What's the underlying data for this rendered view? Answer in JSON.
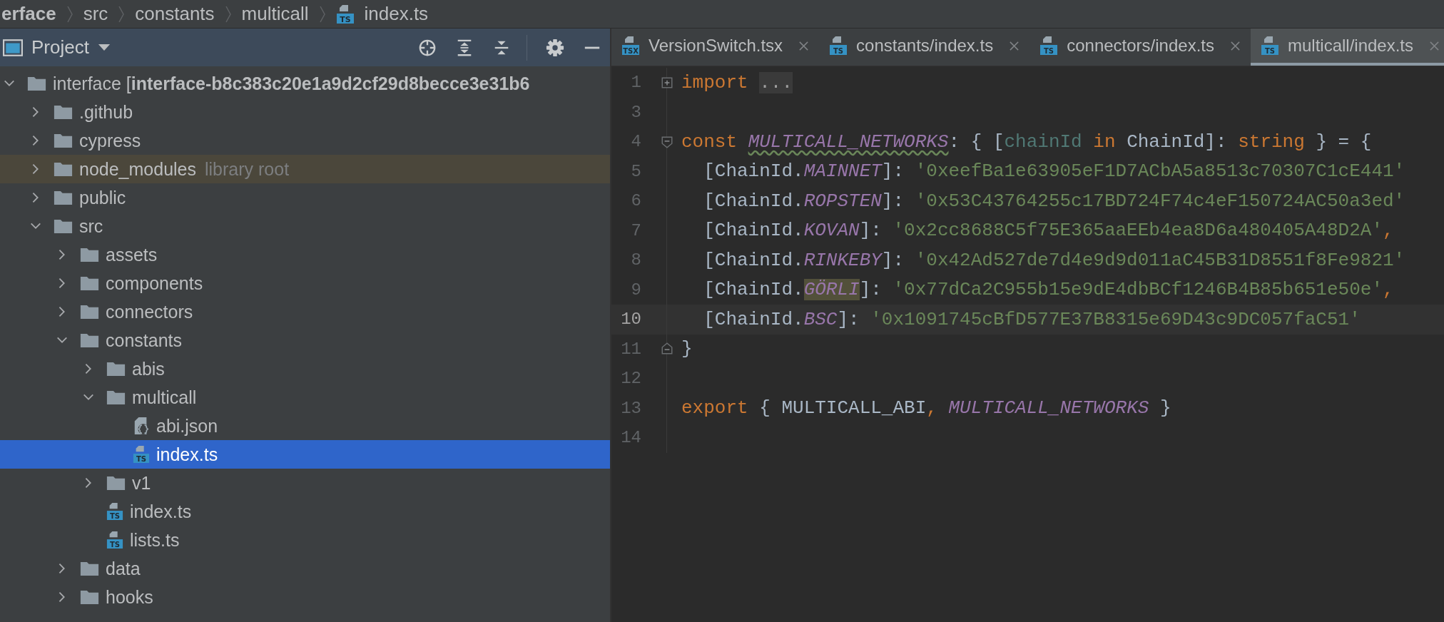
{
  "breadcrumb": [
    {
      "label": "erface",
      "kind": "root"
    },
    {
      "label": "src",
      "kind": "folder"
    },
    {
      "label": "constants",
      "kind": "folder"
    },
    {
      "label": "multicall",
      "kind": "folder"
    },
    {
      "label": "index.ts",
      "kind": "file",
      "badge": "TS"
    }
  ],
  "project_panel": {
    "title": "Project"
  },
  "tree": [
    {
      "name": "interface [**interface-b8c383c20e1a9d2cf29d8becce3e31b6**",
      "kind": "folder",
      "expanded": true,
      "selected": false,
      "children": [
        {
          "name": ".github",
          "kind": "folder",
          "expanded": false,
          "selected": false
        },
        {
          "name": "cypress",
          "kind": "folder",
          "expanded": false,
          "selected": false
        },
        {
          "name": "node_modules",
          "kind": "folder",
          "expanded": false,
          "selected": false,
          "library_root": true,
          "note": "library root"
        },
        {
          "name": "public",
          "kind": "folder",
          "expanded": false,
          "selected": false
        },
        {
          "name": "src",
          "kind": "folder",
          "expanded": true,
          "selected": false,
          "children": [
            {
              "name": "assets",
              "kind": "folder",
              "expanded": false,
              "selected": false
            },
            {
              "name": "components",
              "kind": "folder",
              "expanded": false,
              "selected": false
            },
            {
              "name": "connectors",
              "kind": "folder",
              "expanded": false,
              "selected": false
            },
            {
              "name": "constants",
              "kind": "folder",
              "expanded": true,
              "selected": false,
              "children": [
                {
                  "name": "abis",
                  "kind": "folder",
                  "expanded": false,
                  "selected": false
                },
                {
                  "name": "multicall",
                  "kind": "folder",
                  "expanded": true,
                  "selected": false,
                  "children": [
                    {
                      "name": "abi.json",
                      "kind": "json",
                      "selected": false
                    },
                    {
                      "name": "index.ts",
                      "kind": "ts",
                      "badge": "TS",
                      "selected": true
                    }
                  ]
                },
                {
                  "name": "v1",
                  "kind": "folder",
                  "expanded": false,
                  "selected": false
                },
                {
                  "name": "index.ts",
                  "kind": "ts",
                  "badge": "TS",
                  "selected": false
                },
                {
                  "name": "lists.ts",
                  "kind": "ts",
                  "badge": "TS",
                  "selected": false
                }
              ]
            },
            {
              "name": "data",
              "kind": "folder",
              "expanded": false,
              "selected": false
            },
            {
              "name": "hooks",
              "kind": "folder",
              "expanded": false,
              "selected": false
            }
          ]
        }
      ]
    }
  ],
  "tabs": [
    {
      "label": "VersionSwitch.tsx",
      "badge": "TSX",
      "selected": false
    },
    {
      "label": "constants/index.ts",
      "badge": "TS",
      "selected": false
    },
    {
      "label": "connectors/index.ts",
      "badge": "TS",
      "selected": false
    },
    {
      "label": "multicall/index.ts",
      "badge": "TS",
      "selected": true
    }
  ],
  "code": [
    {
      "number": "1",
      "kind": "foldopen",
      "current": false,
      "tokens": [
        {
          "kind": "keyword",
          "text": "import "
        },
        {
          "kind": "folded",
          "text": "..."
        }
      ]
    },
    {
      "number": "3",
      "current": false
    },
    {
      "number": "4",
      "kind": "foldstart",
      "current": false,
      "tokens": [
        {
          "kind": "keyword",
          "text": "const "
        },
        {
          "kind": "warned",
          "text": "MULTICALL_NETWORKS"
        },
        {
          "kind": "plain",
          "text": ": { ["
        },
        {
          "kind": "param",
          "text": "chainId"
        },
        {
          "kind": "keyword",
          "text": " in"
        },
        {
          "kind": "plain",
          "text": " ChainId]: "
        },
        {
          "kind": "keyword",
          "text": "string"
        },
        {
          "kind": "plain",
          "text": " } = {"
        }
      ]
    },
    {
      "number": "5",
      "current": false,
      "tokens": [
        {
          "kind": "plain",
          "text": "  [ChainId."
        },
        {
          "kind": "constant",
          "text": "MAINNET"
        },
        {
          "kind": "plain",
          "text": "]: "
        },
        {
          "kind": "string",
          "text": "'0xeefBa1e63905eF1D7ACbA5a8513c70307C1cE441'"
        }
      ]
    },
    {
      "number": "6",
      "current": false,
      "tokens": [
        {
          "kind": "plain",
          "text": "  [ChainId."
        },
        {
          "kind": "constant",
          "text": "ROPSTEN"
        },
        {
          "kind": "plain",
          "text": "]: "
        },
        {
          "kind": "string",
          "text": "'0x53C43764255c17BD724F74c4eF150724AC50a3ed'"
        }
      ]
    },
    {
      "number": "7",
      "current": false,
      "tokens": [
        {
          "kind": "plain",
          "text": "  [ChainId."
        },
        {
          "kind": "constant",
          "text": "KOVAN"
        },
        {
          "kind": "plain",
          "text": "]: "
        },
        {
          "kind": "string",
          "text": "'0x2cc8688C5f75E365aaEEb4ea8D6a480405A48D2A'"
        },
        {
          "kind": "keyword",
          "text": ","
        }
      ]
    },
    {
      "number": "8",
      "current": false,
      "tokens": [
        {
          "kind": "plain",
          "text": "  [ChainId."
        },
        {
          "kind": "constant",
          "text": "RINKEBY"
        },
        {
          "kind": "plain",
          "text": "]: "
        },
        {
          "kind": "string",
          "text": "'0x42Ad527de7d4e9d9d011aC45B31D8551f8Fe9821'"
        }
      ]
    },
    {
      "number": "9",
      "current": false,
      "tokens": [
        {
          "kind": "plain",
          "text": "  [ChainId."
        },
        {
          "kind": "marked",
          "text": "GÖRLI"
        },
        {
          "kind": "plain",
          "text": "]: "
        },
        {
          "kind": "string",
          "text": "'0x77dCa2C955b15e9dE4dbBCf1246B4B85b651e50e'"
        },
        {
          "kind": "keyword",
          "text": ","
        }
      ]
    },
    {
      "number": "10",
      "current": true,
      "tokens": [
        {
          "kind": "plain",
          "text": "  [ChainId."
        },
        {
          "kind": "constant",
          "text": "BSC"
        },
        {
          "kind": "plain",
          "text": "]: "
        },
        {
          "kind": "string",
          "text": "'0x1091745cBfD577E37B8315e69D43c9DC057faC51'"
        }
      ]
    },
    {
      "number": "11",
      "kind": "foldend",
      "current": false,
      "tokens": [
        {
          "kind": "plain",
          "text": "}"
        }
      ]
    },
    {
      "number": "12",
      "current": false
    },
    {
      "number": "13",
      "current": false,
      "tokens": [
        {
          "kind": "keyword",
          "text": "export"
        },
        {
          "kind": "plain",
          "text": " { MULTICALL_ABI"
        },
        {
          "kind": "keyword",
          "text": ", "
        },
        {
          "kind": "constant",
          "text": "MULTICALL_NETWORKS"
        },
        {
          "kind": "plain",
          "text": " }"
        }
      ]
    },
    {
      "number": "14",
      "current": false
    }
  ]
}
